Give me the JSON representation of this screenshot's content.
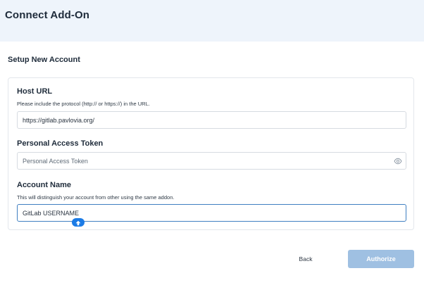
{
  "header": {
    "title": "Connect Add-On"
  },
  "section": {
    "title": "Setup New Account"
  },
  "fields": {
    "host_url": {
      "label": "Host URL",
      "help": "Please include the protocol (http:// or https://) in the URL.",
      "value": "https://gitlab.pavlovia.org/"
    },
    "token": {
      "label": "Personal Access Token",
      "placeholder": "Personal Access Token",
      "value": "",
      "icon": "eye-icon"
    },
    "account_name": {
      "label": "Account Name",
      "help": "This will distinguish your account from other using the same addon.",
      "value": "GitLab USERNAME"
    }
  },
  "footer": {
    "back_label": "Back",
    "authorize_label": "Authorize"
  },
  "colors": {
    "header_bg": "#eef4fb",
    "accent": "#3f7fc1",
    "authorize_disabled": "#9fc0e2",
    "assist_bubble": "#1b7be6"
  }
}
